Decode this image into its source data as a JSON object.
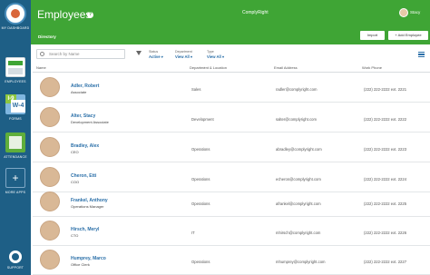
{
  "nav": {
    "dashboard_label": "MY DASHBOARD",
    "employees_label": "EMPLOYEES",
    "forms_label": "FORMS",
    "forms_tile_i9": "I-9",
    "forms_tile_w4": "W-4",
    "attendance_label": "ATTENDANCE",
    "more_apps_label": "MORE APPS",
    "more_apps_glyph": "+",
    "support_label": "SUPPORT"
  },
  "header": {
    "title": "Employees",
    "help_glyph": "?",
    "company": "ComplyRight",
    "user": "Stacy",
    "breadcrumb": "Directory",
    "import_label": "Import",
    "add_label": "+ Add Employee"
  },
  "toolbar": {
    "search_placeholder": "Search by Name",
    "filters": [
      {
        "label": "Status",
        "value": "Active"
      },
      {
        "label": "Department",
        "value": "View All"
      },
      {
        "label": "Type",
        "value": "View All"
      }
    ]
  },
  "table": {
    "columns": [
      "Name",
      "Department & Location",
      "Email Address",
      "Work Phone"
    ],
    "sort_glyph": "↕",
    "rows": [
      {
        "name": "Adler, Robert",
        "title": "Associate",
        "dept": "Sales",
        "email": "radler@complyright.com",
        "phone": "(222) 222-2222 ext. 2221"
      },
      {
        "name": "Alter, Stacy",
        "title": "Development Associate",
        "dept": "Development",
        "email": "salter@complyright.com",
        "phone": "(222) 222-2222 ext. 2222"
      },
      {
        "name": "Bradley, Alex",
        "title": "CEO",
        "dept": "Operations",
        "email": "abradley@complyright.com",
        "phone": "(222) 222-2222 ext. 2223"
      },
      {
        "name": "Cheron, Etti",
        "title": "COO",
        "dept": "Operations",
        "email": "echeron@complyright.com",
        "phone": "(222) 222-2222 ext. 2224"
      },
      {
        "name": "Frankel, Anthony",
        "title": "Operations Manager",
        "dept": "Operations",
        "email": "afrankel@complyright.com",
        "phone": "(222) 222-2222 ext. 2225"
      },
      {
        "name": "Hirsch, Meryl",
        "title": "CTO",
        "dept": "IT",
        "email": "mhirsch@complyright.com",
        "phone": "(222) 222-2222 ext. 2226"
      },
      {
        "name": "Humprey, Marco",
        "title": "Office Clerk",
        "dept": "Operations",
        "email": "mhumprey@complyright.com",
        "phone": "(222) 222-2222 ext. 2227"
      }
    ]
  },
  "colors": {
    "header_green": "#3fa535",
    "nav_blue": "#1e5f86",
    "link_blue": "#2a6fa8"
  }
}
